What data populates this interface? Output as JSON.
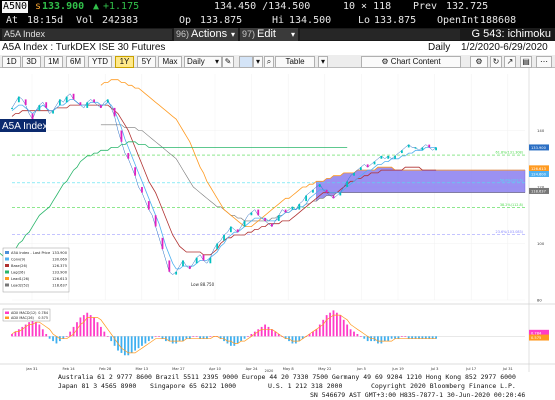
{
  "quote": {
    "ticker": "A5N0",
    "price_prefix": "s",
    "price": "133.900",
    "change": "+1.175",
    "bid_ask": "134.450 /134.500",
    "size": "10 × 118",
    "prev_label": "Prev",
    "prev": "132.725",
    "at_label": "At",
    "time": "18:15d",
    "vol_label": "Vol",
    "volume": "242383",
    "op_label": "Op",
    "open": "133.875",
    "hi_label": "Hi",
    "high": "134.500",
    "lo_label": "Lo",
    "low": "133.875",
    "oi_label": "OpenInt",
    "open_interest": "188608"
  },
  "function_bar": {
    "field_value": "A5A Index",
    "actions_num": "96)",
    "actions_label": "Actions",
    "edit_num": "97)",
    "edit_label": "Edit",
    "function_name": "G 543: ichimoku"
  },
  "title_bar": {
    "security": "A5A Index : TurkDEX ISE 30 Futures",
    "period": "Daily",
    "date_range": "1/2/2020-6/29/2020"
  },
  "toolbar": {
    "ranges": [
      "1D",
      "3D",
      "1M",
      "6M",
      "YTD",
      "1Y",
      "5Y",
      "Max"
    ],
    "selected_range": "1Y",
    "frequency": "Daily",
    "table_label": "Table",
    "chart_content_label": "Chart Content"
  },
  "chart_data": {
    "type": "line",
    "title": "A5A Index",
    "price_axis": {
      "ylim": [
        80,
        160
      ],
      "ticks": [
        80,
        100,
        120,
        140
      ]
    },
    "x_ticks": [
      "Jan 31",
      "Feb 14",
      "Feb 28",
      "Mar 13",
      "Mar 27",
      "Apr 10",
      "Apr 24",
      "May 8",
      "May 22",
      "Jun 5",
      "Jun 19",
      "Jul 3",
      "Jul 17",
      "Jul 31"
    ],
    "x_year_label": "2020",
    "legend": [
      {
        "name": "A5A Index - Last Price",
        "value": "133.900",
        "color": "#4a8fd8"
      },
      {
        "name": "Conv(9)",
        "value": "130.069",
        "color": "#4fb0f0"
      },
      {
        "name": "Base(26)",
        "value": "126.375",
        "color": "#b03030"
      },
      {
        "name": "Lag(26)",
        "value": "133.900",
        "color": "#29b56a"
      },
      {
        "name": "Lead1(26)",
        "value": "126.613",
        "color": "#ff9a20"
      },
      {
        "name": "Lead2(52)",
        "value": "118.637",
        "color": "#777777"
      }
    ],
    "fib_levels": [
      {
        "label": "61.8%(131.308)",
        "value": 131.3,
        "color": "#4ad94a"
      },
      {
        "label": "50.0%(121.5)",
        "value": 121.5,
        "color": "#4fe0f0"
      },
      {
        "label": "38.2%(112.8)",
        "value": 112.8,
        "color": "#4ad94a"
      },
      {
        "label": "23.6%(103.083)",
        "value": 103.1,
        "color": "#8888ff"
      }
    ],
    "right_price_labels": [
      {
        "text": "126.613",
        "value": 126.6,
        "color": "#ff9a20"
      },
      {
        "text": "124.600",
        "value": 124.6,
        "color": "#4fb0f0"
      },
      {
        "text": "118.637",
        "value": 118.6,
        "color": "#777777"
      }
    ],
    "low_annotation": "Low  88.750",
    "price_series": {
      "name": "A5A Index - Last Price",
      "x": [
        0,
        1,
        2,
        3,
        4,
        5,
        6,
        7,
        8,
        9,
        10,
        11,
        12,
        13,
        14,
        15,
        16,
        17,
        18,
        19,
        20,
        21,
        22,
        23,
        24,
        25,
        26,
        27,
        28,
        29,
        30,
        31,
        32,
        33,
        34,
        35,
        36,
        37,
        38,
        39,
        40,
        41,
        42,
        43,
        44,
        45,
        46,
        47,
        48,
        49,
        50,
        51,
        52,
        53,
        54,
        55,
        56,
        57,
        58,
        59,
        60,
        61,
        62,
        63,
        64,
        65,
        66,
        67,
        68,
        69,
        70,
        71,
        72,
        73,
        74,
        75,
        76,
        77,
        78,
        79,
        80,
        81,
        82,
        83,
        84,
        85,
        86,
        87,
        88,
        89,
        90,
        91,
        92,
        93,
        94,
        95,
        96,
        97,
        98,
        99,
        100,
        101,
        102,
        103,
        104,
        105,
        106,
        107,
        108,
        109,
        110,
        111,
        112,
        113,
        114,
        115,
        116,
        117,
        118,
        119,
        120,
        121,
        122,
        123,
        124
      ],
      "values": [
        148,
        150,
        152,
        151,
        149,
        146,
        144,
        147,
        149,
        150,
        148,
        146,
        147,
        149,
        151,
        150,
        152,
        153,
        151,
        150,
        149,
        148,
        150,
        151,
        150,
        149,
        148,
        150,
        151,
        148,
        145,
        140,
        136,
        132,
        130,
        127,
        124,
        120,
        118,
        115,
        112,
        110,
        106,
        102,
        98,
        94,
        90,
        89,
        90,
        92,
        94,
        92,
        91,
        93,
        95,
        96,
        94,
        93,
        95,
        98,
        100,
        101,
        103,
        104,
        106,
        105,
        104,
        106,
        108,
        110,
        111,
        112,
        110,
        109,
        108,
        107,
        106,
        108,
        110,
        112,
        111,
        112,
        113,
        112,
        114,
        115,
        117,
        118,
        119,
        120,
        121,
        119,
        118,
        117,
        116,
        117,
        118,
        120,
        122,
        124,
        125,
        126,
        127,
        128,
        127,
        128,
        129,
        130,
        131,
        130,
        131,
        130,
        131,
        132,
        133,
        134,
        135,
        134,
        134,
        133,
        134,
        135,
        134,
        133,
        134
      ]
    },
    "conversion_line": [
      147,
      148,
      149,
      149,
      148,
      147,
      146,
      147,
      148,
      149,
      148,
      147,
      147,
      148,
      149,
      149,
      150,
      151,
      151,
      150,
      149,
      149,
      149,
      150,
      150,
      150,
      149,
      149,
      150,
      149,
      147,
      144,
      141,
      137,
      134,
      131,
      128,
      125,
      122,
      119,
      116,
      113,
      110,
      107,
      103,
      99,
      96,
      93,
      91,
      91,
      92,
      92,
      92,
      92,
      93,
      94,
      94,
      94,
      95,
      96,
      97,
      99,
      100,
      102,
      103,
      104,
      104,
      105,
      106,
      107,
      108,
      109,
      109,
      109,
      109,
      108,
      108,
      108,
      109,
      110,
      111,
      111,
      112,
      112,
      113,
      113,
      114,
      116,
      117,
      118,
      119,
      119,
      119,
      118,
      118,
      118,
      118,
      119,
      120,
      121,
      122,
      123,
      124,
      125,
      126,
      126,
      127,
      128,
      128,
      129,
      129,
      130,
      130,
      130,
      131,
      131,
      132,
      132,
      133,
      133,
      133,
      134,
      134,
      134,
      134
    ],
    "base_line": [
      145,
      146,
      146,
      147,
      147,
      147,
      147,
      147,
      147,
      147,
      147,
      147,
      147,
      148,
      148,
      148,
      148,
      149,
      149,
      149,
      149,
      149,
      149,
      149,
      149,
      149,
      149,
      149,
      149,
      148,
      147,
      146,
      144,
      142,
      140,
      137,
      134,
      131,
      128,
      125,
      122,
      120,
      118,
      115,
      112,
      109,
      106,
      103,
      101,
      99,
      98,
      97,
      97,
      97,
      97,
      97,
      96,
      96,
      96,
      97,
      98,
      100,
      101,
      102,
      102,
      103,
      103,
      103,
      103,
      104,
      104,
      105,
      105,
      106,
      106,
      107,
      107,
      107,
      107,
      108,
      108,
      108,
      109,
      110,
      111,
      112,
      113,
      114,
      115,
      116,
      117,
      118,
      118,
      118,
      118,
      118,
      119,
      120,
      121,
      122,
      122,
      123,
      123,
      124,
      124,
      125,
      125,
      125,
      126,
      126,
      126,
      126,
      126,
      126,
      126,
      127,
      127,
      127,
      127,
      127,
      126,
      126,
      126,
      126,
      126
    ],
    "lag_line": [
      146,
      145,
      144,
      143,
      141,
      140,
      138,
      136,
      134,
      132,
      131,
      129,
      127,
      124,
      120,
      116,
      113,
      110,
      107,
      104,
      101,
      99,
      97,
      96,
      95,
      96,
      97,
      98,
      100,
      101,
      103,
      104,
      106,
      108,
      110,
      111,
      112,
      113,
      115,
      117,
      119,
      121,
      122,
      124,
      126,
      127,
      129,
      130,
      131,
      131,
      132,
      132,
      133,
      133,
      133,
      134,
      134,
      134,
      135,
      135,
      136,
      136,
      136,
      135,
      135,
      135,
      134,
      134,
      134,
      134,
      134,
      134,
      134,
      134,
      134,
      134,
      134,
      134,
      134,
      134,
      134,
      134,
      134,
      134,
      134,
      134,
      134,
      134,
      134,
      134,
      134,
      134,
      134,
      134,
      134,
      134,
      134,
      134,
      134,
      134,
      134,
      134,
      134,
      134,
      134,
      134,
      134,
      134,
      134,
      134,
      134,
      134,
      134,
      134,
      134,
      134,
      134,
      134,
      134,
      134,
      134,
      134,
      134,
      134,
      134
    ],
    "lead1_line": [
      156,
      157,
      157,
      158,
      158,
      158,
      157,
      157,
      156,
      156,
      155,
      155,
      154,
      153,
      152,
      151,
      150,
      149,
      148,
      147,
      146,
      145,
      144,
      142,
      140,
      138,
      136,
      133,
      130,
      127,
      125,
      122,
      120,
      118,
      116,
      114,
      112,
      111,
      110,
      109,
      108,
      107,
      106,
      106,
      106,
      107,
      108,
      109,
      110,
      111,
      112,
      113,
      114,
      115,
      116,
      116,
      117,
      118,
      119,
      120,
      120,
      121,
      121,
      122,
      122,
      122,
      123,
      123,
      124,
      124,
      124,
      125,
      125,
      125,
      125,
      126,
      126,
      126,
      126,
      126,
      126,
      127,
      127,
      127,
      127,
      127,
      126,
      126,
      126,
      126,
      126,
      126,
      126,
      126,
      126,
      126,
      126,
      126,
      126,
      126,
      126,
      126,
      126,
      126,
      126,
      126,
      126,
      126,
      126,
      126,
      126,
      126,
      126,
      126,
      126,
      126,
      126,
      126,
      126,
      126,
      126,
      126,
      126,
      126,
      126
    ],
    "lead2_line": [
      142,
      142,
      142,
      142,
      142,
      142,
      142,
      141,
      141,
      141,
      141,
      140,
      140,
      139,
      138,
      137,
      136,
      135,
      134,
      133,
      132,
      131,
      130,
      128,
      126,
      124,
      122,
      120,
      119,
      118,
      117,
      116,
      115,
      114,
      113,
      113,
      112,
      111,
      110,
      110,
      109,
      109,
      108,
      108,
      108,
      108,
      108,
      108,
      108,
      108,
      109,
      109,
      110,
      110,
      111,
      111,
      112,
      112,
      113,
      113,
      114,
      114,
      115,
      115,
      116,
      116,
      117,
      117,
      117,
      118,
      118,
      118,
      118,
      118,
      118,
      118,
      118,
      118,
      118,
      118,
      118,
      118,
      118,
      118,
      118,
      118,
      118,
      118,
      118,
      118,
      118,
      118,
      118,
      118,
      118,
      118,
      118,
      118,
      118,
      118,
      118,
      118,
      118,
      118,
      118,
      118,
      118,
      118,
      118,
      118,
      118,
      118,
      118,
      118,
      118,
      118,
      118,
      118,
      118,
      118,
      118,
      118,
      118,
      118,
      118
    ],
    "cloud_start_index": 63,
    "macd": {
      "legend": [
        {
          "name": "ADX MACD(12)",
          "value": "0.784",
          "color": "#ff3cc7"
        },
        {
          "name": "ADX MAC(26)",
          "value": "0.575",
          "color": "#ff9a20"
        }
      ],
      "hist": [
        1,
        2,
        3,
        4,
        5,
        6,
        7,
        6,
        5,
        3,
        1,
        -1,
        -2,
        -3,
        -2,
        -1,
        0,
        2,
        4,
        6,
        8,
        9,
        10,
        9,
        8,
        6,
        4,
        2,
        0,
        -2,
        -4,
        -6,
        -7,
        -8,
        -8,
        -7,
        -6,
        -5,
        -4,
        -3,
        -2,
        -1,
        0,
        0,
        -1,
        -2,
        -2,
        -3,
        -3,
        -2,
        -2,
        -1,
        -1,
        0,
        0,
        -1,
        -1,
        -1,
        0,
        0,
        0,
        -1,
        -2,
        -3,
        -4,
        -4,
        -3,
        -2,
        -1,
        0,
        1,
        2,
        3,
        4,
        5,
        4,
        3,
        2,
        1,
        0,
        -1,
        -2,
        -3,
        -3,
        -2,
        -1,
        0,
        1,
        2,
        3,
        5,
        7,
        9,
        10,
        11,
        10,
        9,
        7,
        5,
        3,
        2,
        1,
        0,
        -1,
        -2,
        -2,
        -2,
        -3,
        -3,
        -2,
        -2,
        -1,
        -1,
        -1,
        0,
        0,
        -1,
        -1,
        -1,
        -1,
        -1,
        -1,
        -1,
        -1,
        -1
      ],
      "signal": [
        1,
        2,
        2,
        3,
        4,
        5,
        5,
        6,
        6,
        5,
        4,
        3,
        1,
        0,
        -1,
        -1,
        -1,
        0,
        1,
        3,
        5,
        6,
        8,
        8,
        8,
        8,
        7,
        5,
        3,
        1,
        -1,
        -3,
        -5,
        -6,
        -7,
        -7,
        -7,
        -6,
        -5,
        -4,
        -3,
        -2,
        -1,
        -1,
        -1,
        -1,
        -2,
        -2,
        -2,
        -2,
        -2,
        -1,
        -1,
        -1,
        -1,
        -1,
        -1,
        -1,
        -1,
        0,
        0,
        -1,
        -1,
        -2,
        -2,
        -3,
        -3,
        -2,
        -2,
        -1,
        0,
        1,
        2,
        3,
        3,
        3,
        3,
        2,
        1,
        0,
        -1,
        -1,
        -2,
        -2,
        -2,
        -1,
        0,
        1,
        2,
        3,
        4,
        5,
        7,
        8,
        9,
        9,
        9,
        8,
        7,
        5,
        4,
        3,
        2,
        1,
        0,
        -1,
        -1,
        -2,
        -2,
        -2,
        -2,
        -2,
        -1,
        -1,
        -1,
        -1,
        -1,
        -1,
        -1,
        -1,
        -1,
        -1,
        -1,
        -1,
        -1
      ],
      "ylim": [
        -10,
        12
      ],
      "right_labels": [
        {
          "text": "0.784",
          "value": 1.5,
          "color": "#ff3cc7"
        },
        {
          "text": "0.575",
          "value": -0.5,
          "color": "#ff9a20"
        }
      ]
    }
  },
  "footer": {
    "line1": "Australia 61 2 9777 8600 Brazil 5511 2395 9000 Europe 44 20 7330 7500 Germany 49 69 9204 1210 Hong Kong 852 2977 6000",
    "line2a": "Japan 81 3 4565 8900",
    "line2b": "Singapore 65 6212 1000",
    "line2c": "U.S. 1 212 318 2000",
    "line2d": "Copyright 2020 Bloomberg Finance L.P.",
    "line3": "SN 546679 AST  GMT+3:00 H835-7877-1 30-Jun-2020 00:20:46"
  },
  "colors": {
    "cloud": "#8a7ef0",
    "cloud_edge": "#6a5ad8",
    "bg": "#ffffff",
    "grid": "#e8e8e8"
  }
}
